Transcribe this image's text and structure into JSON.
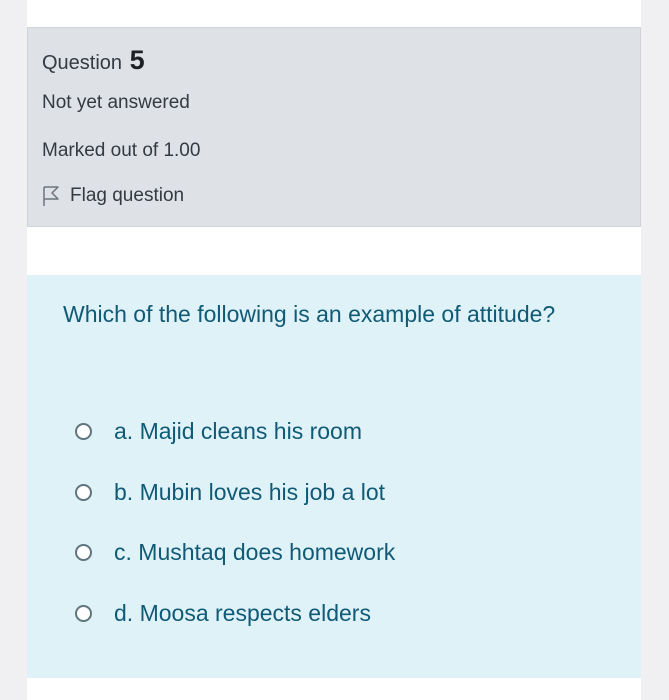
{
  "question_info": {
    "label": "Question",
    "number": "5",
    "state": "Not yet answered",
    "grade": "Marked out of 1.00",
    "flag_label": "Flag question"
  },
  "question": {
    "text": "Which of the following is an example of attitude?",
    "answers": [
      {
        "label": "a. Majid cleans his room"
      },
      {
        "label": "b. Mubin loves his job a lot"
      },
      {
        "label": "c. Mushtaq does homework"
      },
      {
        "label": "d. Moosa respects elders"
      }
    ]
  },
  "colors": {
    "info_bg": "#dee2e6",
    "content_bg": "#def2f8",
    "content_text": "#115a75"
  }
}
